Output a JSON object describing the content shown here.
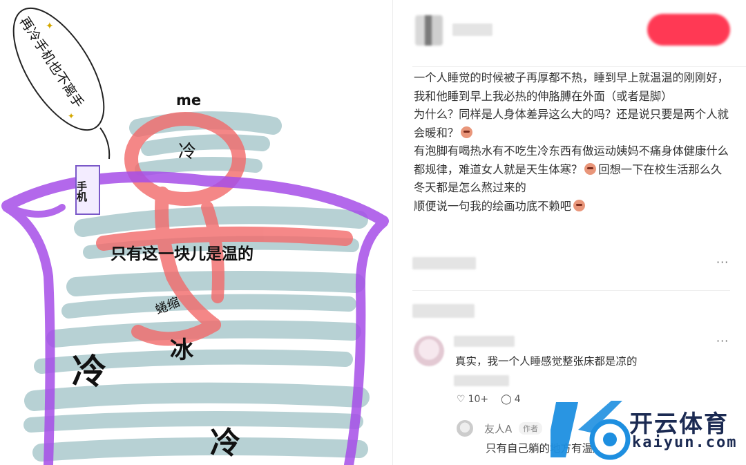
{
  "drawing": {
    "speech_bubble": "再冷手机也不离手",
    "me_label": "me",
    "cold_small": "冷",
    "phone_label": "手机",
    "warm_label": "只有这一块儿是温的",
    "curl_label": "蜷缩",
    "ice_label": "冰",
    "cold_left": "冷",
    "cold_bottom": "冷"
  },
  "post": {
    "paragraphs": [
      "一个人睡觉的时候被子再厚都不热，睡到早上就温温的刚刚好，我和他睡到早上我必热的伸胳膊在外面（或者是脚）",
      "为什么？同样是人身体差异这么大的吗？还是说只要是两个人就会暖和？",
      "有泡脚有喝热水有不吃生冷东西有做运动姨妈不痛身体健康什么都规律，难道女人就是天生体寒？",
      "回想一下在校生活那么久冬天都是怎么熬过来的",
      "顺便说一句我的绘画功底不赖吧"
    ],
    "more": "···"
  },
  "comment": {
    "text": "真实，我一个人睡感觉整张床都是凉的",
    "likes": "10+",
    "replies": "4",
    "more": "···"
  },
  "reply": {
    "name": "友人A",
    "tag": "作者",
    "text": "只有自己躺的地方有温度"
  },
  "watermark": {
    "brand": "开云体育",
    "domain": "kaiyun.com"
  },
  "colors": {
    "purple": "#a64ee8",
    "pink": "#f26a6a",
    "teal": "#9fc2c6",
    "brand_red": "#ff2442",
    "wm_blue": "#1e8fe0"
  }
}
